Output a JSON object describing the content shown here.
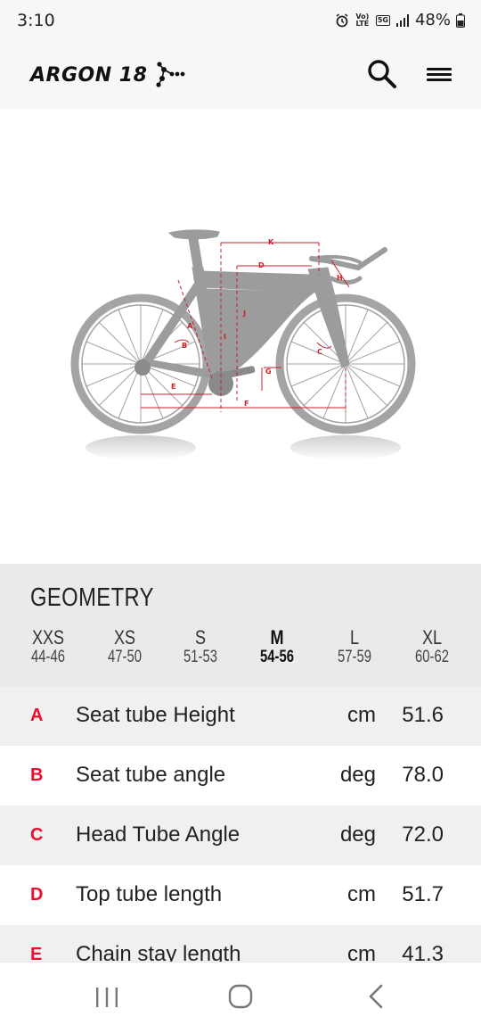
{
  "status_bar": {
    "time": "3:10",
    "network_label": "Vo) LTE",
    "network_gen": "5G",
    "battery": "48%"
  },
  "header": {
    "brand": "ARGON 18",
    "icons": [
      "search-icon",
      "menu-icon"
    ]
  },
  "bike_diagram": {
    "labels": [
      "A",
      "B",
      "C",
      "D",
      "E",
      "F",
      "G",
      "H",
      "I",
      "J",
      "K"
    ],
    "colors": {
      "bike": "#a4a4a4",
      "measure": "#c9202a"
    }
  },
  "geometry": {
    "title": "GEOMETRY",
    "sizes": [
      {
        "name": "XXS",
        "range": "44-46",
        "selected": false
      },
      {
        "name": "XS",
        "range": "47-50",
        "selected": false
      },
      {
        "name": "S",
        "range": "51-53",
        "selected": false
      },
      {
        "name": "M",
        "range": "54-56",
        "selected": true
      },
      {
        "name": "L",
        "range": "57-59",
        "selected": false
      },
      {
        "name": "XL",
        "range": "60-62",
        "selected": false
      }
    ],
    "rows": [
      {
        "letter": "A",
        "label": "Seat tube Height",
        "unit": "cm",
        "value": "51.6"
      },
      {
        "letter": "B",
        "label": "Seat tube angle",
        "unit": "deg",
        "value": "78.0"
      },
      {
        "letter": "C",
        "label": "Head Tube Angle",
        "unit": "deg",
        "value": "72.0"
      },
      {
        "letter": "D",
        "label": "Top tube length",
        "unit": "cm",
        "value": "51.7"
      },
      {
        "letter": "E",
        "label": "Chain stay length",
        "unit": "cm",
        "value": "41.3"
      }
    ],
    "accent_color": "#e8112d"
  },
  "nav_bar": {
    "icons": [
      "recent-apps-icon",
      "home-icon",
      "back-icon"
    ]
  }
}
